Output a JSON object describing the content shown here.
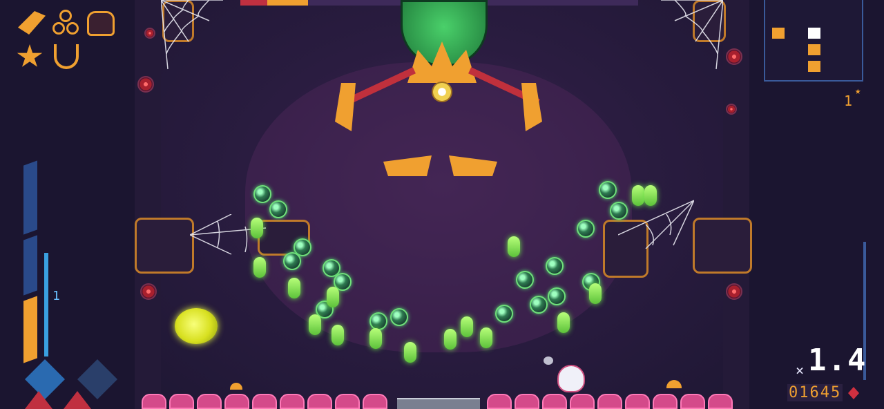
{
  "hud": {
    "ammo_count": "1",
    "multiplier_prefix": "×",
    "multiplier": "1.4",
    "score": "01645",
    "floor_counter": "1"
  },
  "icons": {
    "items": [
      "rocket-icon",
      "triple-orb-icon",
      "jar-icon",
      "star-badge-icon",
      "anchor-icon"
    ],
    "abilities": [
      "blaster-icon",
      "pickaxe-icon",
      "fire-icon",
      "plus-icon"
    ]
  },
  "boss": {
    "health_fraction": 0.17
  },
  "colors": {
    "accent": "#f0a030",
    "slime": "#6be04a",
    "health": "#c03040"
  }
}
